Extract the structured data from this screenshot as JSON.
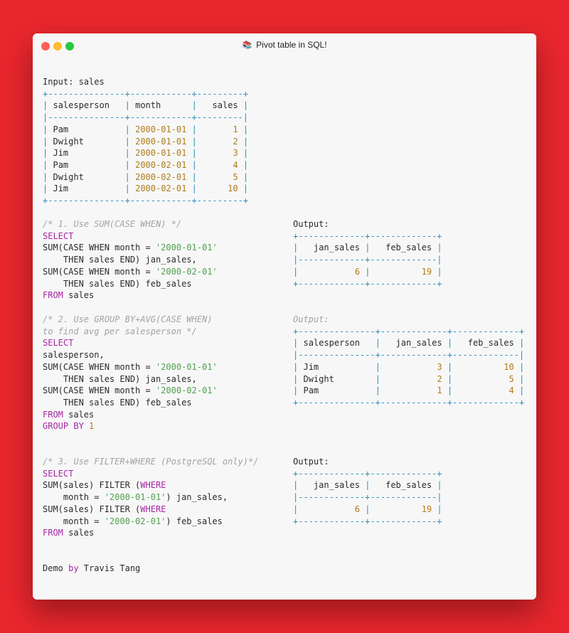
{
  "window": {
    "title": "Pivot table in SQL!",
    "title_icon": "books-icon"
  },
  "colors": {
    "background": "#e8262d",
    "keyword": "#a626a4",
    "string": "#50a14f",
    "number": "#b07c1a",
    "table_border": "#2d8fbf",
    "comment": "#a3a3a3"
  },
  "input_table": {
    "label": "Input: sales",
    "columns": [
      "salesperson",
      "month",
      "sales"
    ],
    "rows": [
      [
        "Pam",
        "2000-01-01",
        "1"
      ],
      [
        "Dwight",
        "2000-01-01",
        "2"
      ],
      [
        "Jim",
        "2000-01-01",
        "3"
      ],
      [
        "Pam",
        "2000-02-01",
        "4"
      ],
      [
        "Dwight",
        "2000-02-01",
        "5"
      ],
      [
        "Jim",
        "2000-02-01",
        "10"
      ]
    ]
  },
  "sections": [
    {
      "comment_lines": [
        "/* 1. Use SUM(CASE WHEN) */"
      ],
      "code_lines": [
        [
          {
            "t": "SELECT",
            "c": "kw"
          }
        ],
        [
          {
            "t": "SUM(CASE WHEN month = "
          },
          {
            "t": "'2000-01-01'",
            "c": "str"
          }
        ],
        [
          {
            "t": "    THEN sales END) jan_sales,"
          }
        ],
        [
          {
            "t": "SUM(CASE WHEN month = "
          },
          {
            "t": "'2000-02-01'",
            "c": "str"
          }
        ],
        [
          {
            "t": "    THEN sales END) feb_sales"
          }
        ],
        [
          {
            "t": "FROM",
            "c": "kw"
          },
          {
            "t": " sales"
          }
        ]
      ],
      "output_label": "Output:",
      "output_label_style": "normal",
      "output_columns": [
        "jan_sales",
        "feb_sales"
      ],
      "output_rows": [
        [
          "6",
          "19"
        ]
      ]
    },
    {
      "comment_lines": [
        "/* 2. Use GROUP BY+AVG(CASE WHEN)",
        "to find avg per salesperson */"
      ],
      "code_lines": [
        [
          {
            "t": "SELECT",
            "c": "kw"
          }
        ],
        [
          {
            "t": "salesperson,"
          }
        ],
        [
          {
            "t": "SUM(CASE WHEN month = "
          },
          {
            "t": "'2000-01-01'",
            "c": "str"
          }
        ],
        [
          {
            "t": "    THEN sales END) jan_sales,"
          }
        ],
        [
          {
            "t": "SUM(CASE WHEN month = "
          },
          {
            "t": "'2000-02-01'",
            "c": "str"
          }
        ],
        [
          {
            "t": "    THEN sales END) feb_sales"
          }
        ],
        [
          {
            "t": "FROM",
            "c": "kw"
          },
          {
            "t": " sales"
          }
        ],
        [
          {
            "t": "GROUP BY",
            "c": "kw"
          },
          {
            "t": " "
          },
          {
            "t": "1",
            "c": "num"
          }
        ]
      ],
      "output_label": "Output:",
      "output_label_style": "dim",
      "output_columns": [
        "salesperson",
        "jan_sales",
        "feb_sales"
      ],
      "output_rows": [
        [
          "Jim",
          "3",
          "10"
        ],
        [
          "Dwight",
          "2",
          "5"
        ],
        [
          "Pam",
          "1",
          "4"
        ]
      ]
    },
    {
      "comment_lines": [
        "/* 3. Use FILTER+WHERE (PostgreSQL only)*/"
      ],
      "code_lines": [
        [
          {
            "t": "SELECT",
            "c": "kw"
          }
        ],
        [
          {
            "t": "SUM(sales) FILTER ("
          },
          {
            "t": "WHERE",
            "c": "kw"
          }
        ],
        [
          {
            "t": "    month = "
          },
          {
            "t": "'2000-01-01'",
            "c": "str"
          },
          {
            "t": ") jan_sales,"
          }
        ],
        [
          {
            "t": "SUM(sales) FILTER ("
          },
          {
            "t": "WHERE",
            "c": "kw"
          }
        ],
        [
          {
            "t": "    month = "
          },
          {
            "t": "'2000-02-01'",
            "c": "str"
          },
          {
            "t": ") feb_sales"
          }
        ],
        [
          {
            "t": "FROM",
            "c": "kw"
          },
          {
            "t": " sales"
          }
        ]
      ],
      "output_label": "Output:",
      "output_label_style": "normal",
      "output_columns": [
        "jan_sales",
        "feb_sales"
      ],
      "output_rows": [
        [
          "6",
          "19"
        ]
      ]
    }
  ],
  "footer": [
    {
      "t": "Demo "
    },
    {
      "t": "by",
      "c": "kw"
    },
    {
      "t": " Travis Tang"
    }
  ]
}
